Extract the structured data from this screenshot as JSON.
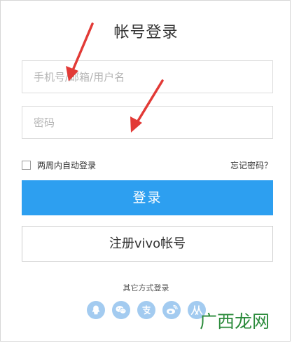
{
  "title": "帐号登录",
  "inputs": {
    "username_placeholder": "手机号/邮箱/用户名",
    "password_placeholder": "密码"
  },
  "remember": {
    "label": "两周内自动登录",
    "checked": false
  },
  "forgot_label": "忘记密码？",
  "login_button_label": "登录",
  "register_button_label": "注册vivo帐号",
  "other_login_label": "其它方式登录",
  "social": [
    {
      "icon": "qq-icon"
    },
    {
      "icon": "wechat-icon"
    },
    {
      "icon": "alipay-icon"
    },
    {
      "icon": "weibo-icon"
    },
    {
      "icon": "renren-icon"
    }
  ],
  "watermark": {
    "text": "广西龙网"
  },
  "colors": {
    "primary": "#2d9ff0",
    "social_icon_bg": "#a3cbf0",
    "annotation_arrow": "#e23a36",
    "watermark": "#2a8a3a"
  }
}
